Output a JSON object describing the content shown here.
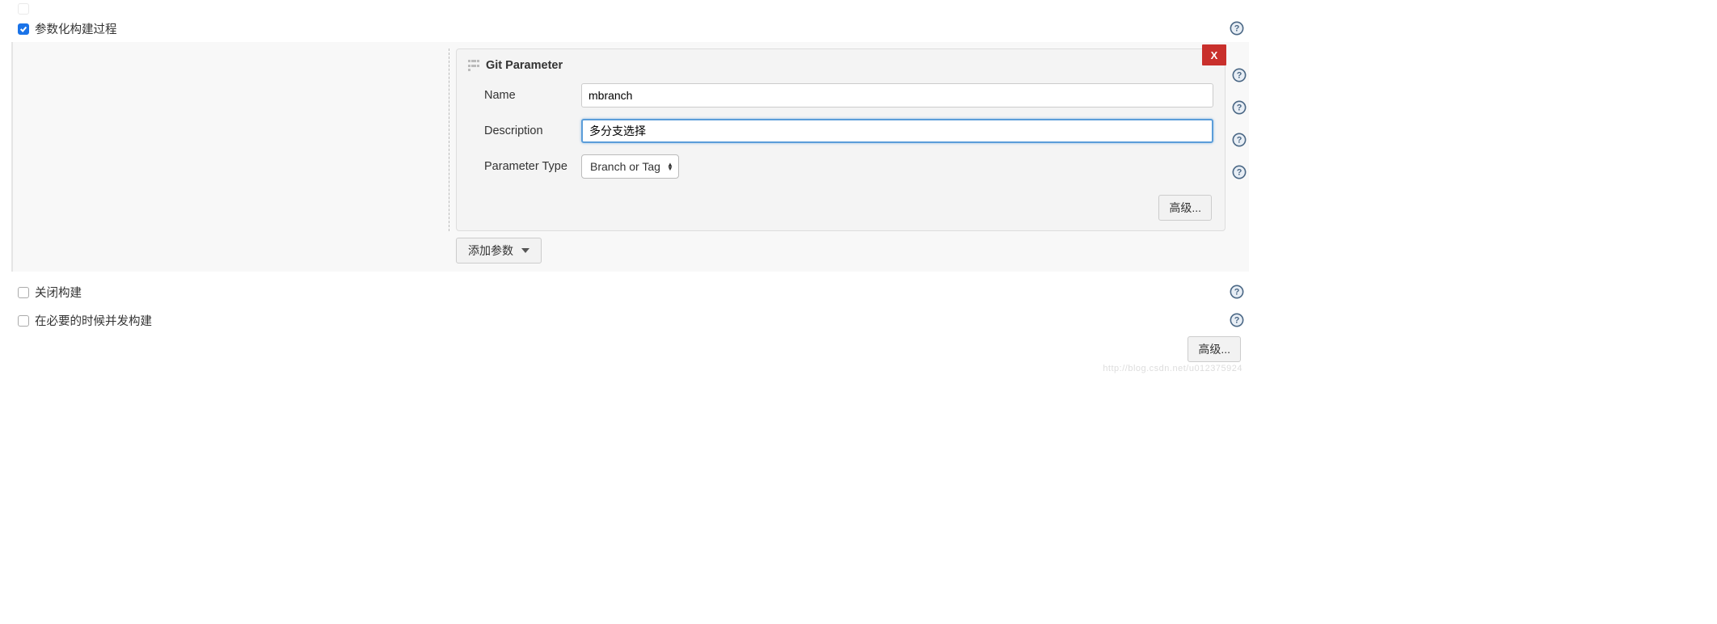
{
  "options": {
    "parameterized": {
      "label": "参数化构建过程",
      "checked": true
    },
    "disable_build": {
      "label": "关闭构建",
      "checked": false
    },
    "concurrent_build": {
      "label": "在必要的时候并发构建",
      "checked": false
    }
  },
  "param_card": {
    "title": "Git Parameter",
    "close": "X",
    "fields": {
      "name": {
        "label": "Name",
        "value": "mbranch"
      },
      "description": {
        "label": "Description",
        "value": "多分支选择"
      },
      "param_type": {
        "label": "Parameter Type",
        "value": "Branch or Tag"
      }
    },
    "advanced_label": "高级..."
  },
  "add_param_label": "添加参数",
  "bottom_advanced_label": "高级...",
  "watermark": "http://blog.csdn.net/u012375924"
}
